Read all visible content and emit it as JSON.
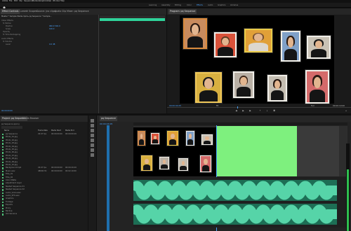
{
  "app": {
    "menu": [
      "Adobe",
      "File",
      "Edit",
      "Clip",
      "Sequence",
      "Markers",
      "Graphics",
      "View",
      "Window",
      "Help"
    ],
    "workspaces": [
      "Learning",
      "Assembly",
      "Editing",
      "Color",
      "Effects",
      "Audio",
      "Graphics",
      "Libraries"
    ],
    "active_workspace": "Effects"
  },
  "source_panel": {
    "tabs": [
      "Effect Controls",
      "Lumetri Scopes",
      "Source: (no clips)",
      "Audio Clip Mixer: pq Sequence"
    ],
    "header": "Master * Sample Media.mp4 ▸ pq Sequence * Sample...",
    "rows": [
      {
        "label": "Video Effects",
        "value": ""
      },
      {
        "label": "fx  Motion",
        "value": ""
      },
      {
        "label": "Position",
        "value": "960.0  540.0"
      },
      {
        "label": "Scale",
        "value": "100.0"
      },
      {
        "label": "Opacity",
        "value": ""
      },
      {
        "label": "fx  Time Remapping",
        "value": ""
      },
      {
        "label": "Audio Effects",
        "value": ""
      },
      {
        "label": "fx  Volume",
        "value": ""
      },
      {
        "label": "Level",
        "value": "0.0 dB"
      }
    ],
    "timecode": "00:00:00:00"
  },
  "program_panel": {
    "tab": "Program: pq Sequence",
    "timecode_left": "00:00:04:05",
    "fit": "Fit",
    "quality": "Full",
    "timecode_right": "00:00:10:00"
  },
  "project_panel": {
    "tabs": [
      "Project: pq Sequence",
      "Media Browser"
    ],
    "project_file": "pq Sequence.prproj",
    "columns": [
      "Name",
      "Frame Rate",
      "Media Start",
      "Media End"
    ],
    "items": [
      {
        "name": "pq Sequence",
        "fps": "29.97 fps",
        "start": "00:00:00:00",
        "end": "00:00:09:29"
      },
      {
        "name": "Photo_01.jpg",
        "fps": "",
        "start": "",
        "end": ""
      },
      {
        "name": "Photo_02.jpg",
        "fps": "",
        "start": "",
        "end": ""
      },
      {
        "name": "Photo_03.jpg",
        "fps": "",
        "start": "",
        "end": ""
      },
      {
        "name": "Photo_04.jpg",
        "fps": "",
        "start": "",
        "end": ""
      },
      {
        "name": "Photo_05.jpg",
        "fps": "",
        "start": "",
        "end": ""
      },
      {
        "name": "Photo_06.jpg",
        "fps": "",
        "start": "",
        "end": ""
      },
      {
        "name": "Photo_07.jpg",
        "fps": "",
        "start": "",
        "end": ""
      },
      {
        "name": "Photo_08.jpg",
        "fps": "",
        "start": "",
        "end": ""
      },
      {
        "name": "Photo_09.jpg",
        "fps": "",
        "start": "",
        "end": ""
      },
      {
        "name": "Photo_10.jpg",
        "fps": "",
        "start": "",
        "end": ""
      },
      {
        "name": "Background.mp4",
        "fps": "29.97 fps",
        "start": "00:00:00:00",
        "end": "00:00:29:29"
      },
      {
        "name": "Music.wav",
        "fps": "48000 Hz",
        "start": "00:00:00:00",
        "end": "00:02:10:00"
      },
      {
        "name": "Title_01",
        "fps": "",
        "start": "",
        "end": ""
      },
      {
        "name": "Title_02",
        "fps": "",
        "start": "",
        "end": ""
      },
      {
        "name": "Color Matte",
        "fps": "",
        "start": "",
        "end": ""
      },
      {
        "name": "Adjustment Layer",
        "fps": "",
        "start": "",
        "end": ""
      },
      {
        "name": "Nested Sequence 01",
        "fps": "",
        "start": "",
        "end": ""
      },
      {
        "name": "Nested Sequence 02",
        "fps": "",
        "start": "",
        "end": ""
      },
      {
        "name": "Audio_Voice.wav",
        "fps": "",
        "start": "",
        "end": ""
      },
      {
        "name": "Audio_SFX.wav",
        "fps": "",
        "start": "",
        "end": ""
      },
      {
        "name": "Graphics",
        "fps": "",
        "start": "",
        "end": ""
      },
      {
        "name": "Footage",
        "fps": "",
        "start": "",
        "end": ""
      },
      {
        "name": "Exports",
        "fps": "",
        "start": "",
        "end": ""
      },
      {
        "name": "Proxy",
        "fps": "",
        "start": "",
        "end": ""
      },
      {
        "name": "Backup",
        "fps": "",
        "start": "",
        "end": ""
      },
      {
        "name": "Old Versions",
        "fps": "",
        "start": "",
        "end": ""
      }
    ]
  },
  "timeline": {
    "tab": "pq Sequence",
    "timecode": "00:00:04:05",
    "tracks": [
      "V3",
      "V2",
      "V1",
      "A1",
      "A2",
      "A3"
    ]
  },
  "colors": {
    "accent": "#4aa3ff",
    "green": "#7ef07e",
    "audio": "#2e9c7a",
    "panel": "#1e1e1e"
  }
}
